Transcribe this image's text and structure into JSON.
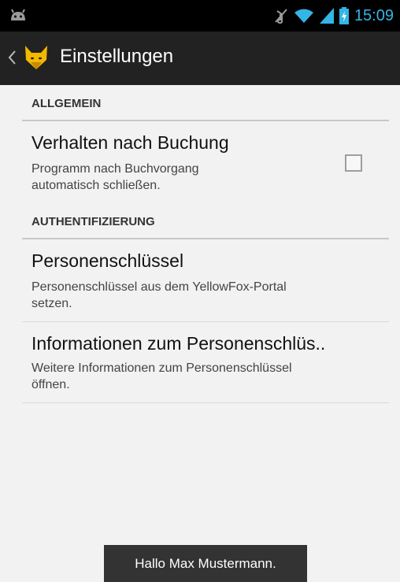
{
  "status_bar": {
    "time": "15:09",
    "icons": [
      "android-icon",
      "mute-icon",
      "wifi-icon",
      "signal-icon",
      "battery-charging-icon"
    ],
    "accent_color": "#33b5e5"
  },
  "action_bar": {
    "title": "Einstellungen",
    "icons": [
      "back-chevron-icon",
      "yellowfox-logo-icon"
    ]
  },
  "sections": [
    {
      "header": "ALLGEMEIN",
      "items": [
        {
          "title": "Verhalten nach Buchung",
          "summary_lines": [
            "Programm nach Buchvorgang",
            "automatisch schließen."
          ],
          "checkbox_checked": false
        }
      ]
    },
    {
      "header": "AUTHENTIFIZIERUNG",
      "items": [
        {
          "title": "Personenschlüssel",
          "summary_lines": [
            "Personenschlüssel aus dem YellowFox-Portal",
            "setzen."
          ]
        },
        {
          "title": "Informationen zum Personenschlüs..",
          "summary_lines": [
            "Weitere Informationen zum Personenschlüssel",
            "öffnen."
          ]
        }
      ]
    }
  ],
  "toast": {
    "message": "Hallo Max Mustermann."
  }
}
